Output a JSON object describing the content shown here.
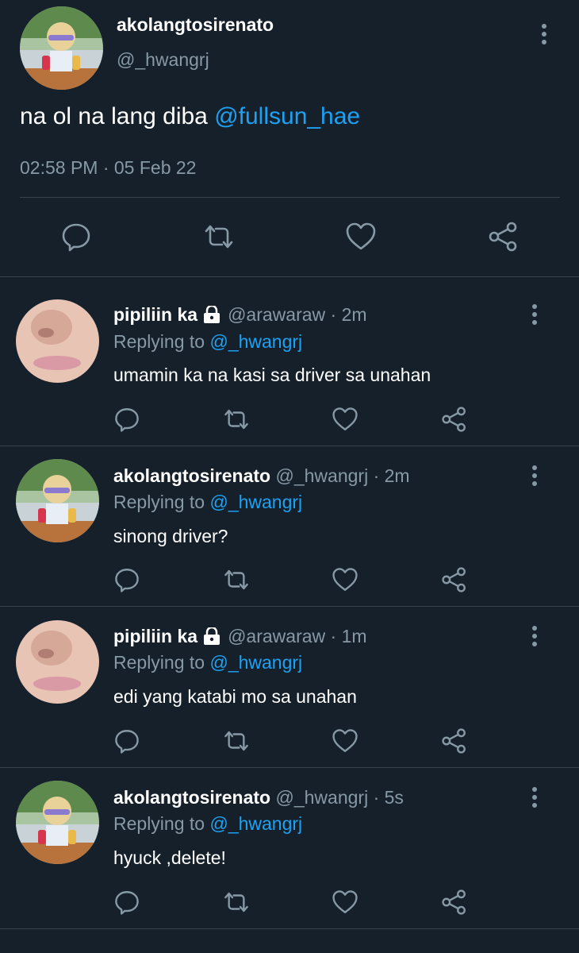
{
  "main_tweet": {
    "display_name": "akolangtosirenato",
    "handle": "@_hwangrj",
    "text": "na ol na lang diba ",
    "mention": "@fullsun_hae",
    "timestamp": "02:58 PM · 05 Feb 22",
    "actions": [
      "reply-icon",
      "retweet-icon",
      "like-icon",
      "share-icon"
    ]
  },
  "replies": [
    {
      "display_name": "pipiliin ka",
      "protected": true,
      "handle_time": "@arawaraw · 2m",
      "replying_prefix": "Replying to ",
      "replying_handle": "@_hwangrj",
      "text": "umamin ka na kasi sa driver sa unahan"
    },
    {
      "display_name": "akolangtosirenato",
      "protected": false,
      "handle_time": "@_hwangrj · 2m",
      "replying_prefix": "Replying to ",
      "replying_handle": "@_hwangrj",
      "text": "sinong driver?"
    },
    {
      "display_name": "pipiliin ka",
      "protected": true,
      "handle_time": "@arawaraw · 1m",
      "replying_prefix": "Replying to ",
      "replying_handle": "@_hwangrj",
      "text": "edi yang katabi mo sa unahan"
    },
    {
      "display_name": "akolangtosirenato",
      "protected": false,
      "handle_time": "@_hwangrj · 5s",
      "replying_prefix": "Replying to ",
      "replying_handle": "@_hwangrj",
      "text": "hyuck ,delete!"
    }
  ],
  "colors": {
    "background": "#15202b",
    "divider": "#38444d",
    "muted": "#8899a6",
    "link": "#1da1f2",
    "text": "#ffffff"
  }
}
